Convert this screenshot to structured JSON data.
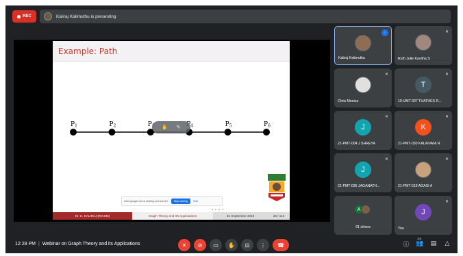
{
  "top_bar": {
    "rec_label": "REC",
    "presenter_text": "Kaliraj Kalimuthu is presenting"
  },
  "slide": {
    "title": "Example:  Path",
    "nodes": [
      "P1",
      "P2",
      "P3",
      "P4",
      "P5",
      "P6"
    ],
    "share_bar": {
      "text": "meet.google.com is sharing your screen.",
      "stop_label": "Stop sharing",
      "hide_label": "Hide"
    },
    "footer": {
      "author": "Dr. K. KALIRAJ  (RIASM)",
      "title": "Graph Theory and It's Applications",
      "date": "24 September 2023",
      "page": "26 / 116"
    }
  },
  "participants": [
    {
      "name": "Kaliraj Kalimuthu",
      "type": "photo",
      "speaking": true
    },
    {
      "name": "Ruth Julie Kavitha S",
      "type": "photo",
      "muted": true
    },
    {
      "name": "Chris Monica",
      "type": "photo",
      "muted": true
    },
    {
      "name": "19-UMT-307 THATHES R...",
      "initial": "T",
      "color": "#455a64",
      "muted": true
    },
    {
      "name": "21-PMT-004 J SHREYA",
      "initial": "J",
      "color": "#12a4af",
      "muted": true
    },
    {
      "name": "21-PMT-030 KALAIVANI R",
      "initial": "K",
      "color": "#f4511e",
      "muted": true
    },
    {
      "name": "21-PMT-036 JAGANATH...",
      "initial": "J",
      "color": "#12a4af",
      "muted": true
    },
    {
      "name": "21-PMT-019 AGASI A",
      "type": "photo",
      "muted": true
    },
    {
      "name": "91 others",
      "initial": "A",
      "color": "#137333",
      "group": true
    },
    {
      "name": "You",
      "initial": "J",
      "color": "#7248b9",
      "muted": true
    }
  ],
  "bottom_bar": {
    "time": "12:28 PM",
    "meeting_title": "Webinar on Graph Theory and its Applications",
    "people_count": "101"
  },
  "colors": {
    "background": "#202124",
    "tile": "#3c4043",
    "accent_red": "#ea4335",
    "slide_title": "#c0392b",
    "footer_red": "#a42929"
  }
}
